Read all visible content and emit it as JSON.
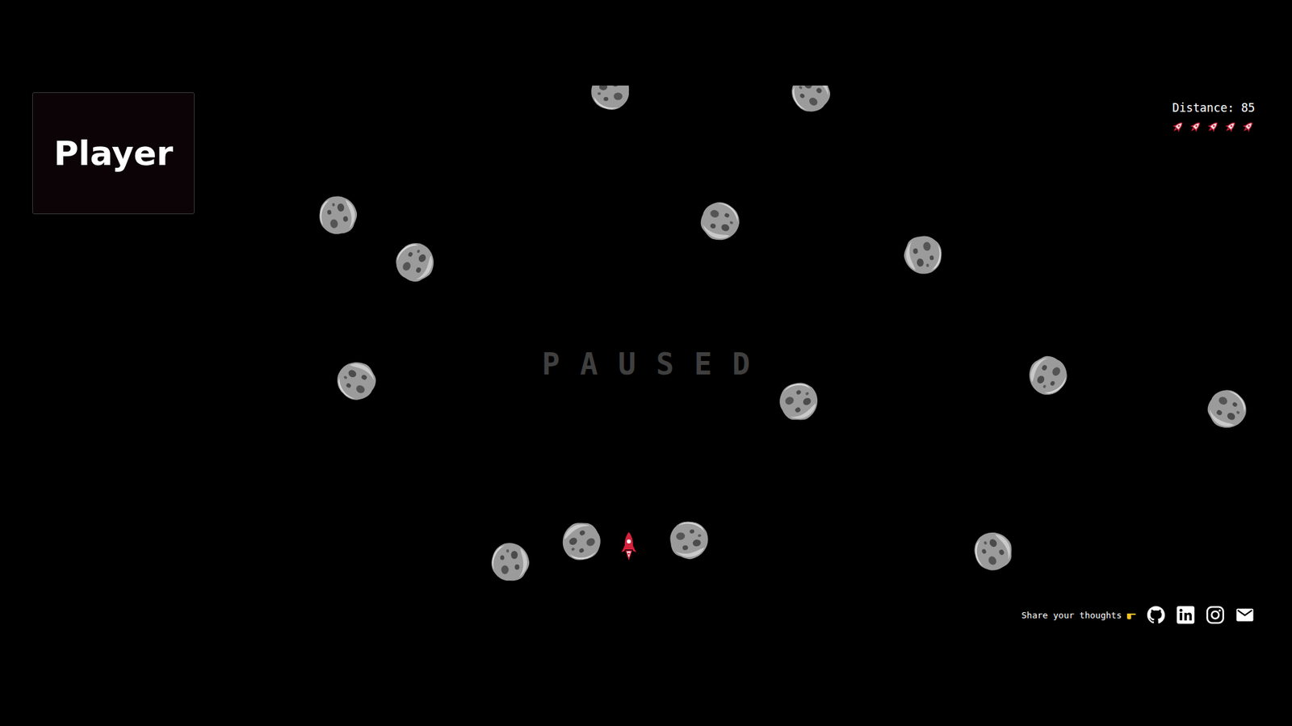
{
  "player_label": {
    "text": "Player"
  },
  "hud": {
    "distance": "Distance: 85",
    "lives": 5
  },
  "overlay": {
    "paused": true,
    "text": "PAUSED"
  },
  "footer": {
    "text": "Share your thoughts"
  }
}
